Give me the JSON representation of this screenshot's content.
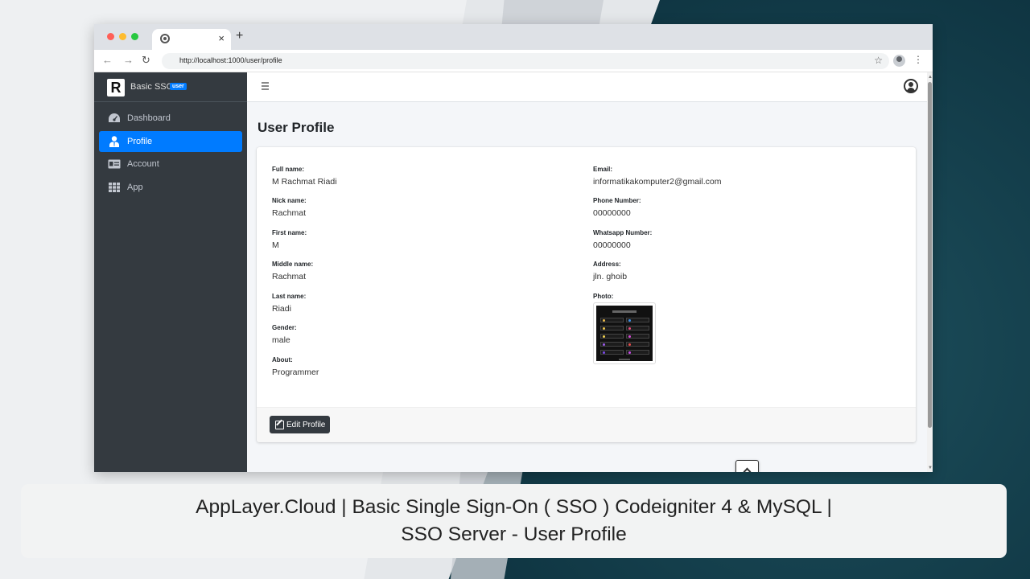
{
  "browser": {
    "tab_close": "×",
    "new_tab": "+",
    "url": "http://localhost:1000/user/profile"
  },
  "sidebar": {
    "brand_logo": "R",
    "brand_name": "Basic SSO",
    "brand_badge": "user",
    "items": [
      {
        "label": "Dashboard",
        "icon": "dashboard-icon",
        "active": false
      },
      {
        "label": "Profile",
        "icon": "user-tie-icon",
        "active": true
      },
      {
        "label": "Account",
        "icon": "id-card-icon",
        "active": false
      },
      {
        "label": "App",
        "icon": "grid-icon",
        "active": false
      }
    ]
  },
  "page": {
    "title": "User Profile",
    "left_fields": [
      {
        "label": "Full name:",
        "value": "M Rachmat Riadi"
      },
      {
        "label": "Nick name:",
        "value": "Rachmat"
      },
      {
        "label": "First name:",
        "value": "M"
      },
      {
        "label": "Middle name:",
        "value": "Rachmat"
      },
      {
        "label": "Last name:",
        "value": "Riadi"
      },
      {
        "label": "Gender:",
        "value": "male"
      },
      {
        "label": "About:",
        "value": "Programmer"
      }
    ],
    "right_fields": [
      {
        "label": "Email:",
        "value": "informatikakomputer2@gmail.com"
      },
      {
        "label": "Phone Number:",
        "value": "00000000"
      },
      {
        "label": "Whatsapp Number:",
        "value": "00000000"
      },
      {
        "label": "Address:",
        "value": "jln. ghoib"
      }
    ],
    "photo_label": "Photo:",
    "edit_button": "Edit Profile"
  },
  "caption": {
    "line1": "AppLayer.Cloud | Basic Single Sign-On ( SSO ) Codeigniter 4 & MySQL |",
    "line2": "SSO Server - User Profile"
  },
  "colors": {
    "sidebar_bg": "#343a40",
    "active_item": "#007bff",
    "content_bg": "#f4f6f9",
    "edit_button_bg": "#343a40"
  }
}
